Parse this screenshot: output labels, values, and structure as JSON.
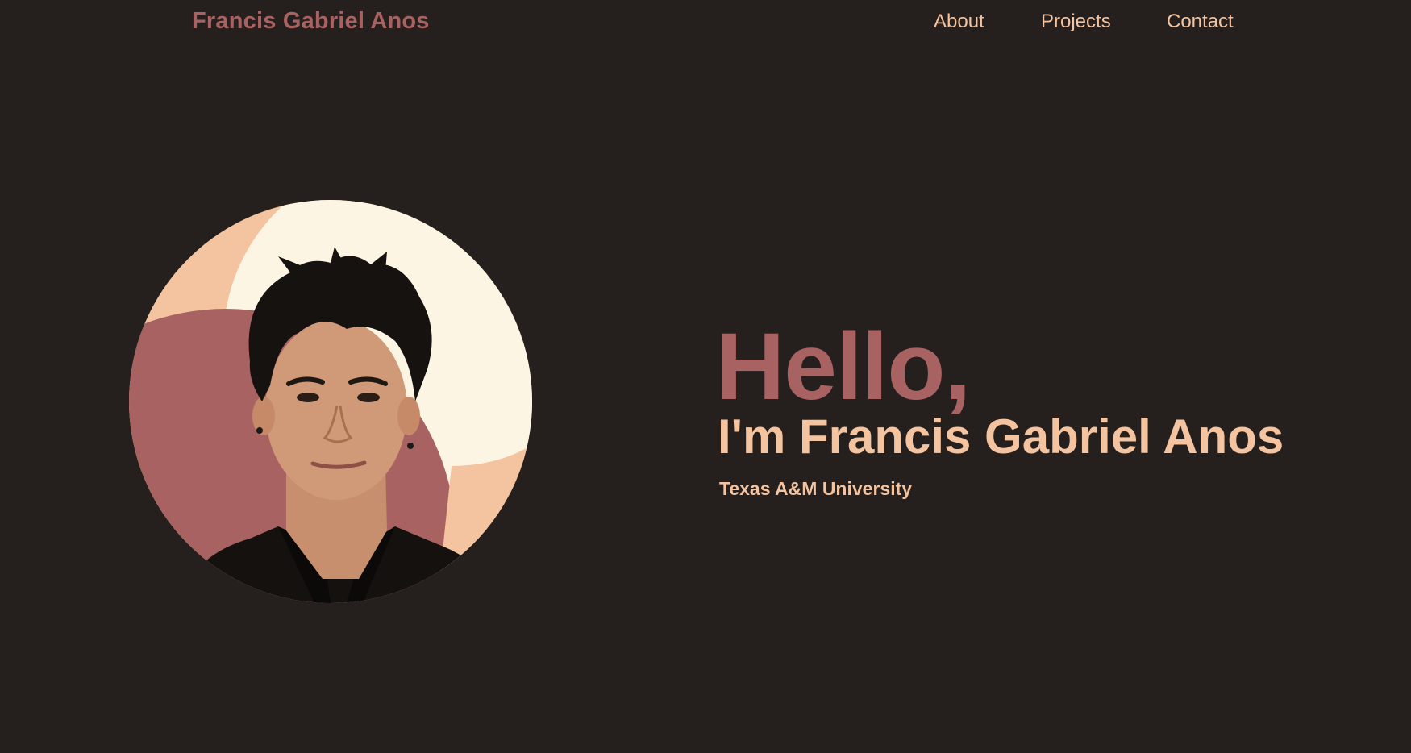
{
  "header": {
    "brand": "Francis Gabriel Anos",
    "nav": {
      "about": "About",
      "projects": "Projects",
      "contact": "Contact"
    }
  },
  "hero": {
    "greeting": "Hello,",
    "intro": "I'm Francis Gabriel Anos",
    "subtitle": "Texas A&M University"
  },
  "colors": {
    "background": "#25201d",
    "accent_rose": "#a96262",
    "accent_peach": "#f4c3a0",
    "cream": "#fdf5e4"
  }
}
